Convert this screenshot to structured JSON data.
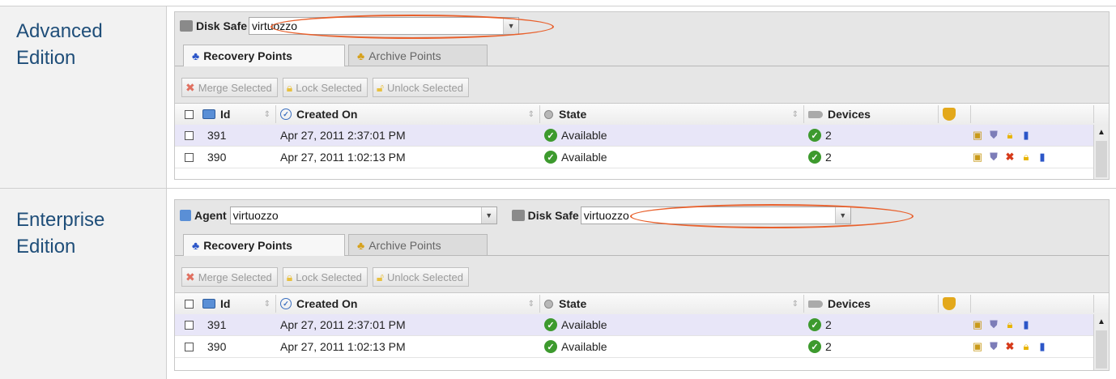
{
  "sections": [
    {
      "edition": "Advanced\nEdition",
      "agent": null,
      "disk_safe": {
        "label": "Disk Safe",
        "value": "virtuozzo"
      }
    },
    {
      "edition": "Enterprise\nEdition",
      "agent": {
        "label": "Agent",
        "value": "virtuozzo"
      },
      "disk_safe": {
        "label": "Disk Safe",
        "value": "virtuozzo"
      }
    }
  ],
  "tabs": {
    "recovery": "Recovery Points",
    "archive": "Archive Points"
  },
  "actions": {
    "merge": "Merge Selected",
    "lock": "Lock Selected",
    "unlock": "Unlock Selected"
  },
  "columns": {
    "id": "Id",
    "created": "Created On",
    "state": "State",
    "devices": "Devices"
  },
  "rows": [
    {
      "id": "391",
      "created": "Apr 27, 2011 2:37:01 PM",
      "state": "Available",
      "devices": "2",
      "actions": [
        "browse-icon",
        "shield-icon",
        "lock-icon",
        "book-icon"
      ]
    },
    {
      "id": "390",
      "created": "Apr 27, 2011 1:02:13 PM",
      "state": "Available",
      "devices": "2",
      "actions": [
        "browse-icon",
        "shield-icon",
        "delete-icon",
        "lock-icon",
        "book-icon"
      ]
    }
  ],
  "colors": {
    "edition_text": "#1f4e79",
    "highlight": "#e8602c",
    "selected_row": "#e8e6f8",
    "ok": "#3d9a2e"
  }
}
